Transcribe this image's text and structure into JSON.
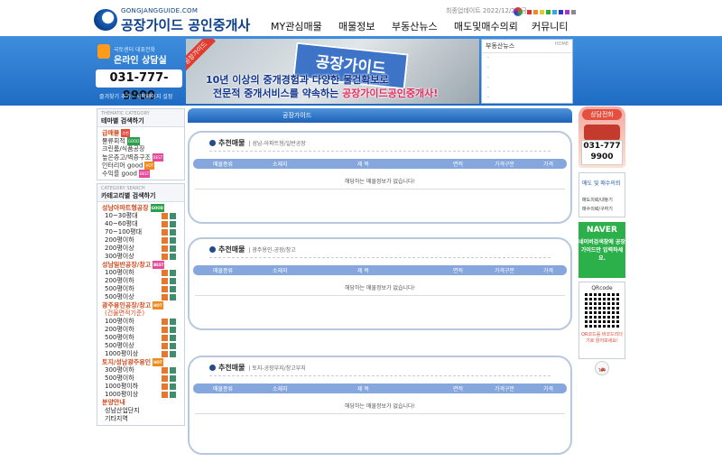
{
  "header": {
    "domain": "GONGJANGGUIDE.COM",
    "site_name": "공장가이드 공인중개사",
    "update_text": "최종업데이트 2022/12/23 금",
    "nav": [
      "MY관심매물",
      "매물정보",
      "부동산뉴스",
      "매도및매수의뢰",
      "커뮤니티"
    ]
  },
  "consult": {
    "label_small": "국토센터 대표전화",
    "label": "온라인 상담실",
    "phone": "031-777-9900",
    "links": "즐겨찾기 추가  ·  시작페이지 설정"
  },
  "banner": {
    "tag": "공장가이드",
    "sign": "공장가이드",
    "line1": "10년 이상의 중개경험과 다양한 물건확보로",
    "line2_prefix": "전문적 중개서비스를 약속하는 ",
    "line2_em": "공장가이드공인중개사!"
  },
  "news": {
    "title": "부동산뉴스",
    "more": "HOME"
  },
  "left": {
    "theme": {
      "small": "THEMATIC CATEGORY",
      "title": "테마별 검색하기",
      "items": [
        {
          "label": "급매물",
          "badge": "추천",
          "color": "#e44f3f"
        },
        {
          "label": "물류회적",
          "badge": "GOOD",
          "color": "#2aa04a"
        },
        {
          "label": "크린룸/식품공장",
          "badge": "",
          "color": ""
        },
        {
          "label": "높은층고/벽층구조",
          "badge": "BEST",
          "color": "#e64a9c"
        },
        {
          "label": "인터리어 good",
          "badge": "HOT",
          "color": "#f08a1d"
        },
        {
          "label": "수익률 good",
          "badge": "BEST",
          "color": "#e64a9c"
        }
      ]
    },
    "category": {
      "small": "CATEGORY SEARCH",
      "title": "카테고리별 검색하기",
      "groups": [
        {
          "label": "성남아파트형공장",
          "badge": "GOOD",
          "color": "#2aa04a",
          "items": [
            "10~30평대",
            "40~60평대",
            "70~100평대",
            "200평이하",
            "200평이상",
            "300평이상"
          ]
        },
        {
          "label": "성남일반공장/창고",
          "badge": "BEST",
          "color": "#e64a9c",
          "items": [
            "100평이하",
            "200평이하",
            "500평이하",
            "500평이상"
          ]
        },
        {
          "label": "광주용인공장/창고",
          "badge": "HOT",
          "color": "#f08a1d",
          "items": [
            "(건물면적기준)",
            "100평이하",
            "200평이하",
            "500평이하",
            "500평이상",
            "1000평이상"
          ]
        },
        {
          "label": "토지/성남광주용인",
          "badge": "HOT",
          "color": "#f08a1d",
          "items": [
            "300평이하",
            "500평이하",
            "1000평이하",
            "1000평이상"
          ]
        },
        {
          "label": "분양안내",
          "badge": "",
          "color": "",
          "items": [
            "성남산업단지",
            "기타지역"
          ]
        }
      ]
    }
  },
  "main": {
    "breadcrumb": "공장가이드",
    "columns": [
      "매물종류",
      "소재지",
      "제    목",
      "면적",
      "가격구분",
      "가격"
    ],
    "empty": "해당하는 매물정보가 없습니다!",
    "sections": [
      {
        "title": "추천매물",
        "path": "|  성남-아파트형/일반공장"
      },
      {
        "title": "추천매물",
        "path": "|  광주용인-공장/창고"
      },
      {
        "title": "추천매물",
        "path": "|  토지-공장부지/창고부지"
      }
    ]
  },
  "right": {
    "consult_title": "상담전화",
    "phone": "031-777 9900",
    "request_title": "매도 및 매수의뢰",
    "request_1": "매도의뢰/내놓기",
    "request_2": "매수의뢰/구하기",
    "naver": "NAVER",
    "naver_text": "네이버검색창에 공장가이드만 입력하세요.",
    "qr_title": "QRcode",
    "qr_text": "QR코드를 바코드리더기로 읽어보세요!",
    "top": "TOP"
  }
}
